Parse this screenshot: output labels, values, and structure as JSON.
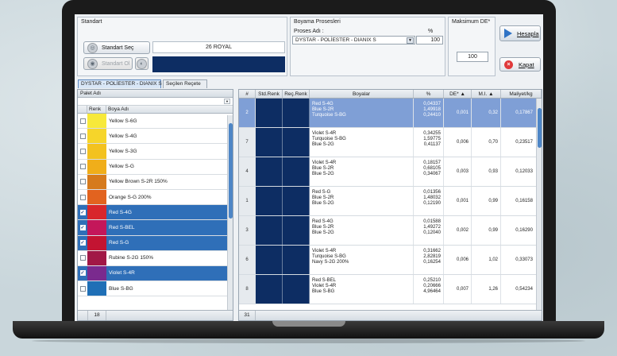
{
  "standard": {
    "group_title": "Standart",
    "select_button": "Standart Seç",
    "measure_button": "Standart Ol",
    "standard_name": "26 ROYAL",
    "standard_color": "#0d2d63"
  },
  "dyeing_process": {
    "group_title": "Boyama Prosesleri",
    "process_label": "Proses Adı :",
    "percent_label": "%",
    "process_value": "DYSTAR - POLİESTER - DIANIX S",
    "percent_value": "100"
  },
  "max_de": {
    "group_title": "Maksimum DE*",
    "value": "100"
  },
  "actions": {
    "calculate_label": "Hesapla",
    "close_label": "Kapat"
  },
  "tabs": [
    {
      "label": "DYSTAR - POLİESTER - DIANIX S"
    },
    {
      "label": "Seçilen Reçete"
    }
  ],
  "palette": {
    "header": "Palet Adı",
    "col_color": "Renk",
    "col_name": "Boya Adı",
    "footer_count": "18",
    "items": [
      {
        "name": "Yellow S-6G",
        "color": "#f7e93a",
        "checked": false,
        "selected": false
      },
      {
        "name": "Yellow S-4G",
        "color": "#f6d52a",
        "checked": false,
        "selected": false
      },
      {
        "name": "Yellow S-3G",
        "color": "#f3c21f",
        "checked": false,
        "selected": false
      },
      {
        "name": "Yellow S-G",
        "color": "#f0ae1a",
        "checked": false,
        "selected": false
      },
      {
        "name": "Yellow Brown S-2R 150%",
        "color": "#d67a1c",
        "checked": false,
        "selected": false
      },
      {
        "name": "Orange S-G 200%",
        "color": "#e2631f",
        "checked": false,
        "selected": false
      },
      {
        "name": "Red S-4G",
        "color": "#d8262b",
        "checked": true,
        "selected": true
      },
      {
        "name": "Red S-BEL",
        "color": "#c4175a",
        "checked": true,
        "selected": true
      },
      {
        "name": "Red S-G",
        "color": "#c31432",
        "checked": true,
        "selected": true
      },
      {
        "name": "Rubine S-2G 150%",
        "color": "#a11846",
        "checked": false,
        "selected": false
      },
      {
        "name": "Violet S-4R",
        "color": "#7a2a8e",
        "checked": true,
        "selected": true
      },
      {
        "name": "Blue S-BG",
        "color": "#1f6fb6",
        "checked": false,
        "selected": false
      }
    ]
  },
  "recipes": {
    "headers": {
      "no": "#",
      "std_color": "Std.Renk",
      "rec_color": "Reç.Renk",
      "dyes": "Boyalar",
      "percent": "%",
      "de": "DE*",
      "mi": "M.I.",
      "cost": "Maliyet/kg"
    },
    "footer_count": "31",
    "rows": [
      {
        "no": "2",
        "dyes": [
          "Red S-4G",
          "Blue S-2R",
          "Turquoise S-BG"
        ],
        "pcts": [
          "0,04337",
          "1,49918",
          "0,24410"
        ],
        "de": "0,001",
        "mi": "0,32",
        "cost": "0,17867",
        "selected": true
      },
      {
        "no": "7",
        "dyes": [
          "Violet S-4R",
          "Turquoise S-BG",
          "Blue S-2G"
        ],
        "pcts": [
          "0,34255",
          "1,59775",
          "0,41137"
        ],
        "de": "0,006",
        "mi": "0,70",
        "cost": "0,23517",
        "selected": false
      },
      {
        "no": "4",
        "dyes": [
          "Violet S-4R",
          "Blue S-2R",
          "Blue S-2G"
        ],
        "pcts": [
          "0,18157",
          "0,68105",
          "0,34067"
        ],
        "de": "0,003",
        "mi": "0,93",
        "cost": "0,12033",
        "selected": false
      },
      {
        "no": "1",
        "dyes": [
          "Red S-G",
          "Blue S-2R",
          "Blue S-2G"
        ],
        "pcts": [
          "0,01356",
          "1,48032",
          "0,12190"
        ],
        "de": "0,001",
        "mi": "0,99",
        "cost": "0,16158",
        "selected": false
      },
      {
        "no": "3",
        "dyes": [
          "Red S-4G",
          "Blue S-2R",
          "Blue S-2G"
        ],
        "pcts": [
          "0,01588",
          "1,49272",
          "0,12040"
        ],
        "de": "0,002",
        "mi": "0,99",
        "cost": "0,16290",
        "selected": false
      },
      {
        "no": "6",
        "dyes": [
          "Violet S-4R",
          "Turquoise S-BG",
          "Navy S-2G 200%"
        ],
        "pcts": [
          "0,31662",
          "2,82819",
          "0,16254"
        ],
        "de": "0,006",
        "mi": "1,02",
        "cost": "0,33073",
        "selected": false
      },
      {
        "no": "8",
        "dyes": [
          "Red S-BEL",
          "Violet S-4R",
          "Blue S-BG"
        ],
        "pcts": [
          "0,25210",
          "0,20666",
          "4,96464"
        ],
        "de": "0,007",
        "mi": "1,26",
        "cost": "0,54234",
        "selected": false
      }
    ]
  },
  "colors": {
    "selection_blue": "#2f6fb8",
    "row_highlight": "#7f9fd6",
    "swatch_navy": "#0d2d63"
  }
}
